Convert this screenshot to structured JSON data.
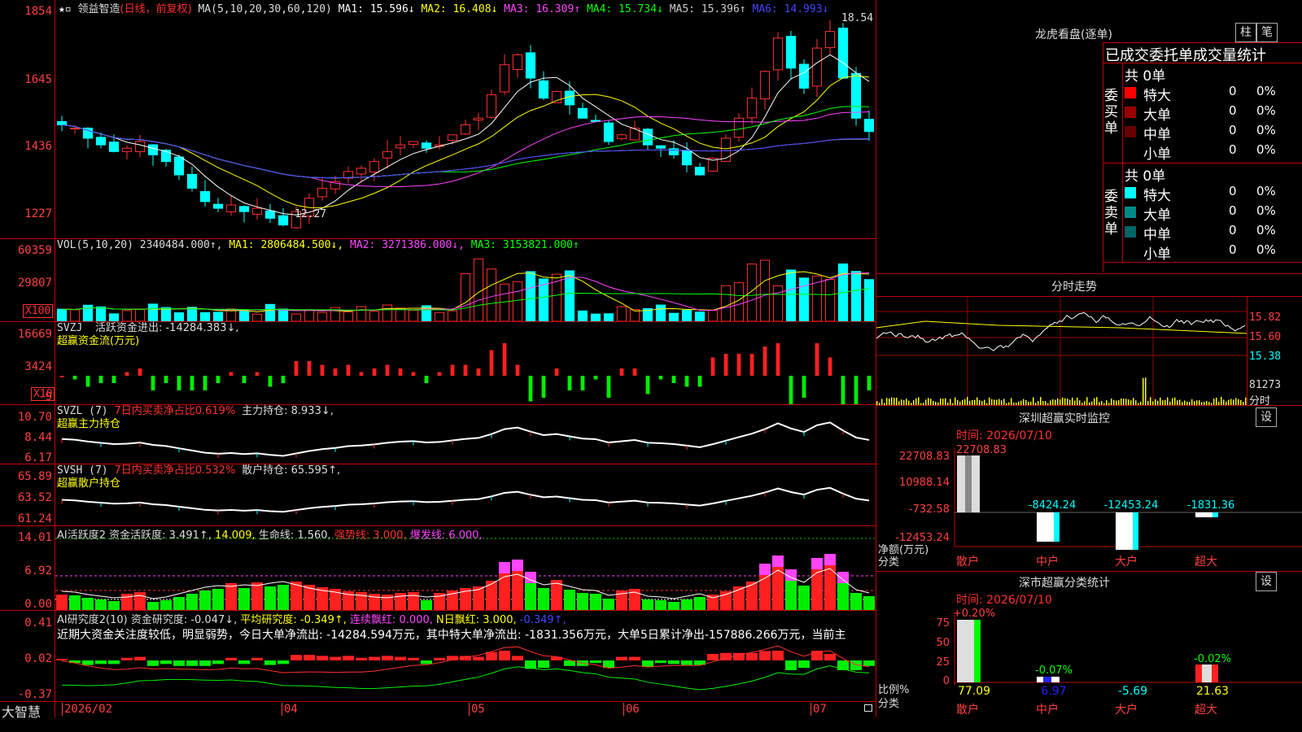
{
  "stock": {
    "name": "领益智造",
    "period": "(日线，前复权)"
  },
  "ma_header": {
    "label": "MA(5,10,20,30,60,120)",
    "items": [
      {
        "text": "MA1: 15.596↓",
        "color": "#ffffff"
      },
      {
        "text": "MA2: 16.408↓",
        "color": "#ffff00"
      },
      {
        "text": "MA3: 16.309↑",
        "color": "#ff44ff"
      },
      {
        "text": "MA4: 15.734↓",
        "color": "#00ff00"
      },
      {
        "text": "MA5: 15.396↑",
        "color": "#cccccc"
      },
      {
        "text": "MA6: 14.993↓",
        "color": "#4444ff"
      }
    ]
  },
  "price_axis": [
    "1854",
    "1645",
    "1436",
    "1227"
  ],
  "price_annotations": {
    "high": "18.54",
    "low": "12.27"
  },
  "vol_header": {
    "label": "VOL(5,10,20)",
    "value": "2340484.000↑,",
    "items": [
      {
        "text": "MA1: 2806484.500↓,",
        "color": "#ffff00"
      },
      {
        "text": "MA2: 3271386.000↓,",
        "color": "#ff44ff"
      },
      {
        "text": "MA3: 3153821.000↑",
        "color": "#00ff00"
      }
    ]
  },
  "vol_axis": [
    "60359",
    "29807"
  ],
  "vol_multiplier": "X100",
  "svzj": {
    "label": "SVZJ",
    "line1": "活跃资金进出: -14284.383↓,",
    "line2": "超赢资金流(万元)"
  },
  "svzj_axis": [
    "16669",
    "3424",
    "-9"
  ],
  "svzj_multiplier": "X10",
  "svzl": {
    "label": "SVZL (7)",
    "ratio": "7日内买卖净占比0.619%",
    "hold": "主力持仓: 8.933↓,",
    "line2": "超赢主力持仓"
  },
  "svzl_axis": [
    "10.70",
    "8.44",
    "6.17"
  ],
  "svsh": {
    "label": "SVSH (7)",
    "ratio": "7日内买卖净占比0.532%",
    "hold": "散户持仓: 65.595↑,",
    "line2": "超赢散户持仓"
  },
  "svsh_axis": [
    "65.89",
    "63.52",
    "61.24"
  ],
  "ai_active": {
    "label": "AI活跃度2",
    "a": "资金活跃度: 3.491↑,",
    "b": "14.009,",
    "c": "生命线: 1.560,",
    "d": "强势线: 3.000,",
    "e": "爆发线: 6.000,"
  },
  "ai_active_axis": [
    "14.01",
    "6.92",
    "0.00"
  ],
  "ai_research": {
    "label": "AI研究度2(10)",
    "a": "资金研究度: -0.047↓,",
    "b": "平均研究度: -0.349↑,",
    "c": "连续飘红: 0.000,",
    "d": "N日飘红: 3.000,",
    "e": "-0.349↑,"
  },
  "ai_research_text": "近期大资金关注度较低，明显弱势，今日大单净流出: -14284.594万元，其中特大单净流出: -1831.356万元，大单5日累计净出-157886.266万元，当前主",
  "ai_research_axis": [
    "0.41",
    "0.02",
    "-0.37"
  ],
  "date_axis": {
    "brand": "大智慧",
    "labels": [
      "2026/02",
      "04",
      "05",
      "06",
      "07"
    ]
  },
  "dragon_tiger": {
    "title": "龙虎看盘(逐单)",
    "btn_bar": "柱",
    "btn_list": "笔",
    "subtitle": "已成交委托单成交量统计",
    "buy_label": "委买单",
    "sell_label": "委卖单",
    "buy_total": "共 0单",
    "sell_total": "共 0单",
    "buy_rows": [
      {
        "name": "特大",
        "count": "0",
        "pct": "0%",
        "color": "#ff0000"
      },
      {
        "name": "大单",
        "count": "0",
        "pct": "0%",
        "color": "#990000"
      },
      {
        "name": "中单",
        "count": "0",
        "pct": "0%",
        "color": "#660000"
      },
      {
        "name": "小单",
        "count": "0",
        "pct": "0%",
        "color": "#000000"
      }
    ],
    "sell_rows": [
      {
        "name": "特大",
        "count": "0",
        "pct": "0%",
        "color": "#00ffff"
      },
      {
        "name": "大单",
        "count": "0",
        "pct": "0%",
        "color": "#008888"
      },
      {
        "name": "中单",
        "count": "0",
        "pct": "0%",
        "color": "#006666"
      },
      {
        "name": "小单",
        "count": "0",
        "pct": "0%",
        "color": "#000000"
      }
    ]
  },
  "intraday": {
    "title": "分时走势",
    "prices": [
      "15.82",
      "15.60",
      "15.38"
    ],
    "vol": "81273",
    "vol_unit": "分时"
  },
  "sz_monitor": {
    "title": "深圳超赢实时监控",
    "btn": "设",
    "time": "时间: 2026/07/10",
    "top_value": "22708.83",
    "axis": [
      "22708.83",
      "10988.14",
      "-732.58",
      "-12453.24"
    ],
    "ylabel": "净额(万元)",
    "xlabel": "分类",
    "categories": [
      "散户",
      "中户",
      "大户",
      "超大"
    ],
    "values": [
      "",
      "-8424.24",
      "-12453.24",
      "-1831.36"
    ]
  },
  "sz_class": {
    "title": "深市超赢分类统计",
    "btn": "设",
    "time": "时间: 2026/07/10",
    "axis": [
      "75",
      "50",
      "25",
      "0"
    ],
    "ylabel": "比例%",
    "xlabel": "分类",
    "categories": [
      "散户",
      "中户",
      "大户",
      "超大"
    ],
    "top_labels": [
      "+0.20%",
      "-0.07%",
      "",
      "-0.02%"
    ],
    "bottom_values": [
      "77.09",
      "6.97",
      "-5.69",
      "21.63"
    ]
  },
  "chart_data": [
    {
      "type": "candlestick",
      "title": "领益智造",
      "ylim": [
        12.27,
        18.54
      ],
      "annotations": [
        "18.54",
        "12.27"
      ],
      "close_series_approx": [
        15.4,
        15.3,
        15.0,
        14.8,
        14.6,
        14.7,
        14.9,
        14.5,
        14.3,
        13.9,
        13.5,
        13.1,
        12.9,
        13.0,
        12.8,
        12.9,
        12.6,
        12.4,
        12.8,
        13.2,
        13.5,
        13.7,
        14.0,
        14.1,
        14.3,
        14.6,
        14.8,
        14.9,
        14.7,
        14.8,
        15.1,
        15.4,
        15.6,
        16.3,
        17.2,
        17.5,
        16.8,
        16.2,
        16.4,
        16.0,
        15.6,
        15.5,
        14.9,
        15.1,
        15.3,
        14.8,
        14.7,
        14.5,
        14.2,
        13.9,
        14.4,
        15.0,
        15.6,
        16.2,
        17.0,
        18.0,
        17.1,
        16.5,
        17.7,
        18.2,
        16.8,
        15.6,
        15.2
      ]
    }
  ]
}
